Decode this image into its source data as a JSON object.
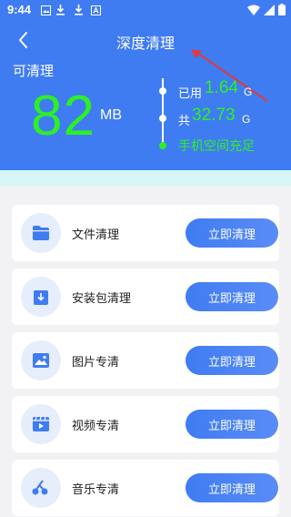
{
  "status_bar": {
    "time": "9:44",
    "left_icons": [
      "image-icon",
      "download-icon",
      "download-icon",
      "font-icon"
    ],
    "right_icons": [
      "wifi-icon",
      "signal-icon",
      "battery-icon"
    ]
  },
  "header": {
    "title": "深度清理",
    "back_icon": "back-arrow-icon",
    "cleanable_label": "可清理",
    "cleanable_value": "82",
    "cleanable_unit": "MB",
    "used_label": "已用",
    "used_value": "1.64",
    "used_unit": "G",
    "total_label": "共",
    "total_value": "32.73",
    "total_unit": "G",
    "storage_status": "手机空间充足"
  },
  "items": [
    {
      "label": "文件清理",
      "icon": "folder-icon",
      "button": "立即清理"
    },
    {
      "label": "安装包清理",
      "icon": "package-download-icon",
      "button": "立即清理"
    },
    {
      "label": "图片专清",
      "icon": "image-icon",
      "button": "立即清理"
    },
    {
      "label": "视频专清",
      "icon": "video-icon",
      "button": "立即清理"
    },
    {
      "label": "音乐专清",
      "icon": "music-icon",
      "button": "立即清理"
    }
  ],
  "colors": {
    "primary": "#3f7cf2",
    "highlight_green": "#2df024",
    "band": "#d6f6f7",
    "annotation_red": "#e03a3a"
  }
}
